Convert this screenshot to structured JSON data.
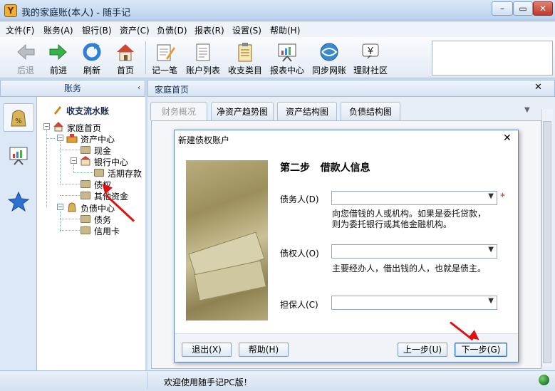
{
  "window": {
    "title": "我的家庭账(本人) - 随手记",
    "app_icon": "Y",
    "controls": {
      "minimize": "–",
      "maximize": "▭",
      "close": "✕"
    }
  },
  "menu": [
    "文件(F)",
    "账务(A)",
    "银行(B)",
    "资产(C)",
    "负债(D)",
    "报表(R)",
    "设置(S)",
    "帮助(H)"
  ],
  "toolbar": [
    {
      "label": "后退",
      "icon": "back-arrow-icon",
      "disabled": true
    },
    {
      "label": "前进",
      "icon": "forward-arrow-icon"
    },
    {
      "label": "刷新",
      "icon": "refresh-icon"
    },
    {
      "label": "首页",
      "icon": "home-icon"
    },
    {
      "label": "记一笔",
      "icon": "notepad-pencil-icon"
    },
    {
      "label": "账户列表",
      "icon": "account-list-icon"
    },
    {
      "label": "收支类目",
      "icon": "clipboard-icon"
    },
    {
      "label": "报表中心",
      "icon": "report-board-icon"
    },
    {
      "label": "同步网账",
      "icon": "sync-globe-icon"
    },
    {
      "label": "理财社区",
      "icon": "yuan-speech-icon"
    }
  ],
  "left_panel": {
    "header": "账务",
    "collapse": "‹",
    "tree_title": "收支流水账",
    "tree": [
      {
        "label": "家庭首页",
        "level": 0
      },
      {
        "label": "资产中心",
        "level": 1
      },
      {
        "label": "现金",
        "level": 2
      },
      {
        "label": "银行中心",
        "level": 2
      },
      {
        "label": "活期存款",
        "level": 3
      },
      {
        "label": "债权",
        "level": 2
      },
      {
        "label": "其他资金",
        "level": 2
      },
      {
        "label": "负债中心",
        "level": 1
      },
      {
        "label": "债务",
        "level": 2
      },
      {
        "label": "信用卡",
        "level": 2
      }
    ]
  },
  "right_panel": {
    "title": "家庭首页",
    "close": "✕",
    "tabs": [
      "财务概况",
      "净资产趋势图",
      "资产结构图",
      "负债结构图"
    ],
    "tab_menu": "▼"
  },
  "dialog": {
    "title": "新建债权账户",
    "close": "✕",
    "step_title": "第二步   借款人信息",
    "fields": [
      {
        "label": "债务人(D)",
        "value": "",
        "hint": "向您借钱的人或机构。如果是委托贷款，\n则为委托银行或其他金融机构。",
        "required": "*"
      },
      {
        "label": "债权人(O)",
        "value": "",
        "hint": "主要经办人，借出钱的人，也就是债主。"
      },
      {
        "label": "担保人(C)",
        "value": "",
        "hint": ""
      }
    ],
    "buttons": {
      "exit": "退出(X)",
      "help": "帮助(H)",
      "prev": "上一步(U)",
      "next": "下一步(G)"
    }
  },
  "status": {
    "text": "欢迎使用随手记PC版！"
  }
}
